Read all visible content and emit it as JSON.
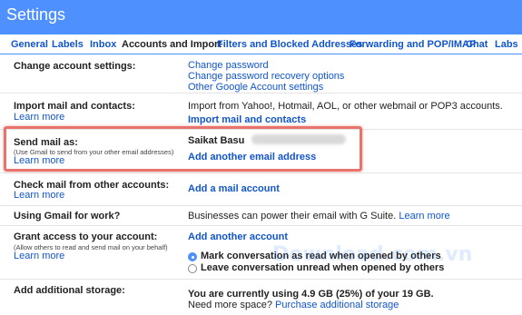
{
  "header": {
    "title": "Settings"
  },
  "tabs": [
    {
      "label": "General"
    },
    {
      "label": "Labels"
    },
    {
      "label": "Inbox"
    },
    {
      "label": "Accounts and Import"
    },
    {
      "label": "Filters and Blocked Addresses"
    },
    {
      "label": "Forwarding and POP/IMAP"
    },
    {
      "label": "Chat"
    },
    {
      "label": "Labs"
    }
  ],
  "rows": {
    "change_account": {
      "label": "Change account settings:",
      "links": [
        "Change password",
        "Change password recovery options",
        "Other Google Account settings"
      ]
    },
    "import": {
      "label": "Import mail and contacts:",
      "learn_more": "Learn more",
      "description": "Import from Yahoo!, Hotmail, AOL, or other webmail or POP3 accounts.",
      "action": "Import mail and contacts"
    },
    "send_mail": {
      "label": "Send mail as:",
      "subtext": "(Use Gmail to send from your other email addresses)",
      "learn_more": "Learn more",
      "name": "Saikat Basu",
      "action": "Add another email address"
    },
    "check_mail": {
      "label": "Check mail from other accounts:",
      "learn_more": "Learn more",
      "action": "Add a mail account"
    },
    "work": {
      "label": "Using Gmail for work?",
      "description": "Businesses can power their email with G Suite.",
      "learn_more": "Learn more"
    },
    "grant": {
      "label": "Grant access to your account:",
      "subtext": "(Allow others to read and send mail on your behalf)",
      "learn_more": "Learn more",
      "action": "Add another account",
      "options": [
        {
          "label": "Mark conversation as read when opened by others",
          "selected": true
        },
        {
          "label": "Leave conversation unread when opened by others",
          "selected": false
        }
      ]
    },
    "storage": {
      "label": "Add additional storage:",
      "usage": "You are currently using 4.9 GB (25%) of your 19 GB.",
      "need_more": "Need more space?",
      "action": "Purchase additional storage"
    }
  },
  "watermark": "Download.com.vn",
  "colors": {
    "header_bg": "#4d90fe",
    "link": "#1155cc",
    "highlight": "#e8736b"
  }
}
